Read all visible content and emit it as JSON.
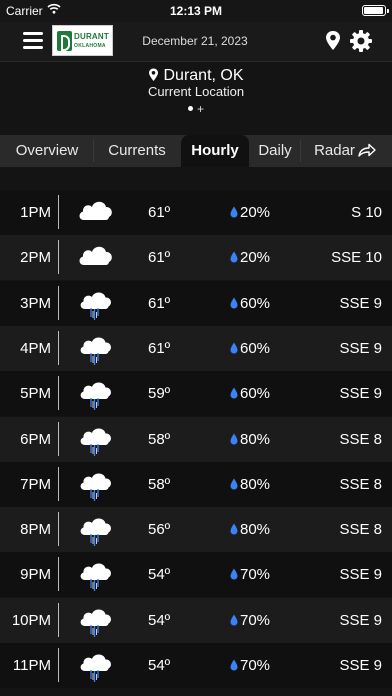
{
  "status": {
    "carrier": "Carrier",
    "time": "12:13 PM"
  },
  "header": {
    "logo_line1": "DURANT",
    "logo_line2": "OKLAHOMA",
    "date": "December 21, 2023"
  },
  "location": {
    "city": "Durant, OK",
    "subtitle": "Current Location",
    "add_symbol": "+"
  },
  "tabs": [
    {
      "label": "Overview",
      "active": false
    },
    {
      "label": "Currents",
      "active": false
    },
    {
      "label": "Hourly",
      "active": true
    },
    {
      "label": "Daily",
      "active": false
    },
    {
      "label": "Radar",
      "active": false
    }
  ],
  "hourly": [
    {
      "time": "1PM",
      "icon": "cloudy-icon",
      "temp": "61º",
      "precip": "20%",
      "wind": "S 10"
    },
    {
      "time": "2PM",
      "icon": "cloudy-icon",
      "temp": "61º",
      "precip": "20%",
      "wind": "SSE 10"
    },
    {
      "time": "3PM",
      "icon": "rain-cloud-icon",
      "temp": "61º",
      "precip": "60%",
      "wind": "SSE 9"
    },
    {
      "time": "4PM",
      "icon": "rain-cloud-icon",
      "temp": "61º",
      "precip": "60%",
      "wind": "SSE 9"
    },
    {
      "time": "5PM",
      "icon": "rain-cloud-icon",
      "temp": "59º",
      "precip": "60%",
      "wind": "SSE 9"
    },
    {
      "time": "6PM",
      "icon": "rain-cloud-icon",
      "temp": "58º",
      "precip": "80%",
      "wind": "SSE 8"
    },
    {
      "time": "7PM",
      "icon": "rain-cloud-icon",
      "temp": "58º",
      "precip": "80%",
      "wind": "SSE 8"
    },
    {
      "time": "8PM",
      "icon": "rain-cloud-icon",
      "temp": "56º",
      "precip": "80%",
      "wind": "SSE 8"
    },
    {
      "time": "9PM",
      "icon": "rain-cloud-icon",
      "temp": "54º",
      "precip": "70%",
      "wind": "SSE 9"
    },
    {
      "time": "10PM",
      "icon": "rain-cloud-icon",
      "temp": "54º",
      "precip": "70%",
      "wind": "SSE 9"
    },
    {
      "time": "11PM",
      "icon": "rain-cloud-icon",
      "temp": "54º",
      "precip": "70%",
      "wind": "SSE 9"
    }
  ],
  "colors": {
    "background": "#141414",
    "row_dark": "#101010",
    "row_light": "#1c1c1c",
    "precip_drop": "#3b82f6",
    "rain_streak": "#3b82f6",
    "brand_green": "#1f7a3a"
  }
}
